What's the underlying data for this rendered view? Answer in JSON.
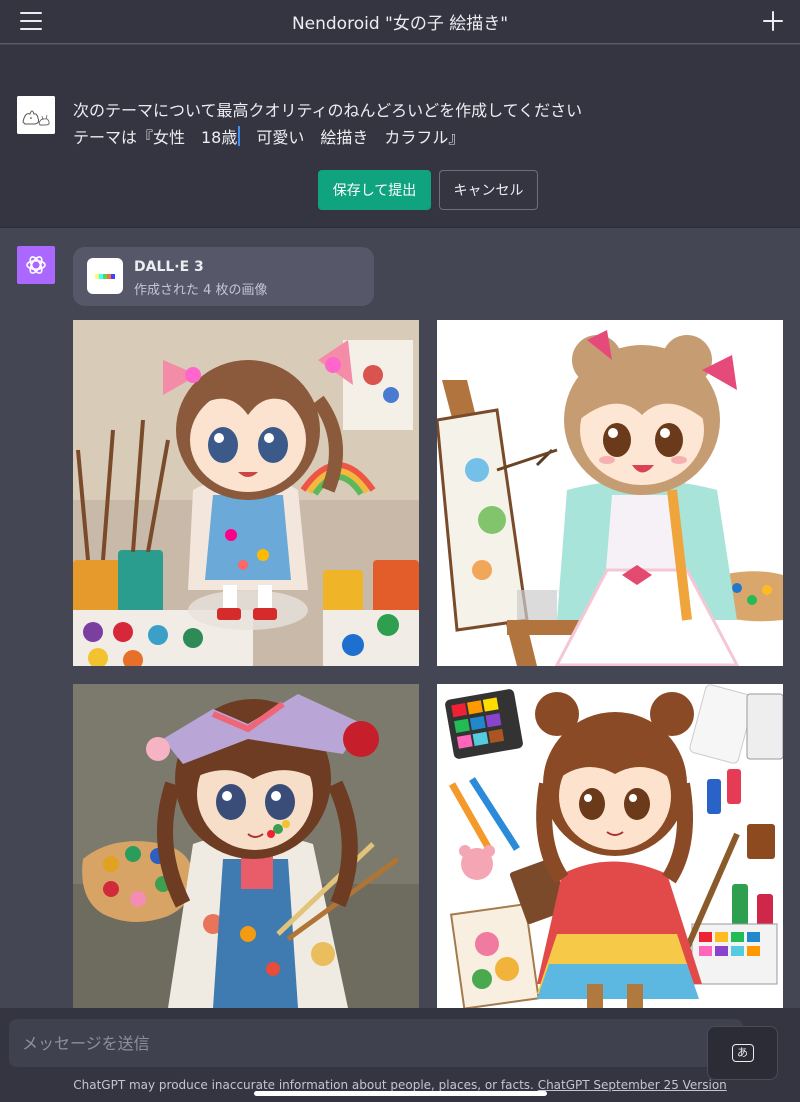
{
  "header": {
    "title": "Nendoroid \"女の子 絵描き\""
  },
  "user_message": {
    "line1": "次のテーマについて最高クオリティのねんどろいどを作成してください",
    "line2": "テーマは『女性　18歳",
    "line2_after_caret": "　可愛い　絵描き　カラフル』",
    "save_label": "保存して提出",
    "cancel_label": "キャンセル"
  },
  "assistant": {
    "tool_title": "DALL·E 3",
    "tool_subtitle": "作成された 4 枚の画像"
  },
  "composer": {
    "placeholder": "メッセージを送信",
    "keyboard_key": "あ",
    "disclaimer_prefix": "ChatGPT may produce inaccurate information about people, places, or facts. ",
    "disclaimer_link": "ChatGPT September 25 Version"
  },
  "colors": {
    "accent_green": "#10a37f",
    "gpt_avatar_purple": "#ab68ff",
    "background": "#444654"
  }
}
